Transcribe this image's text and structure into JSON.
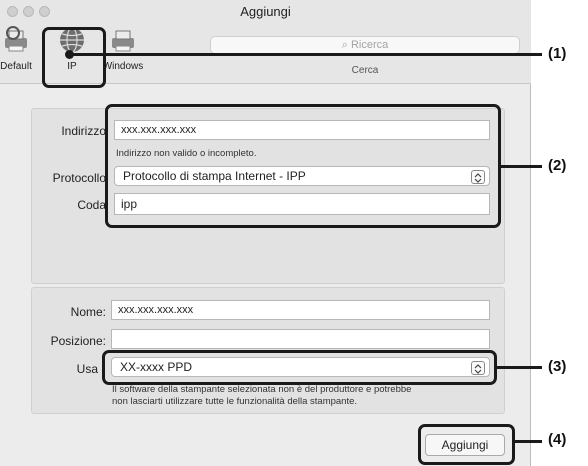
{
  "window": {
    "title": "Aggiungi"
  },
  "toolbar": {
    "buttons": [
      {
        "label": "Default"
      },
      {
        "label": "IP"
      },
      {
        "label": "Windows"
      }
    ],
    "search_placeholder": "Ricerca",
    "search_caption": "Cerca"
  },
  "form": {
    "address_label": "Indirizzo",
    "address_value": "xxx.xxx.xxx.xxx",
    "address_hint": "Indirizzo non valido o incompleto.",
    "protocol_label": "Protocollo",
    "protocol_value": "Protocollo di stampa Internet - IPP",
    "queue_label": "Coda",
    "queue_value": "ipp"
  },
  "info": {
    "name_label": "Nome:",
    "name_value": "xxx.xxx.xxx.xxx",
    "location_label": "Posizione:",
    "location_value": "",
    "use_label": "Usa",
    "use_value": "XX-xxxx PPD",
    "note_line1": "Il software della stampante selezionata non è del produttore e potrebbe",
    "note_line2": "non lasciarti utilizzare tutte le funzionalità della stampante."
  },
  "add_button": "Aggiungi",
  "callouts": [
    "(1)",
    "(2)",
    "(3)",
    "(4)"
  ]
}
